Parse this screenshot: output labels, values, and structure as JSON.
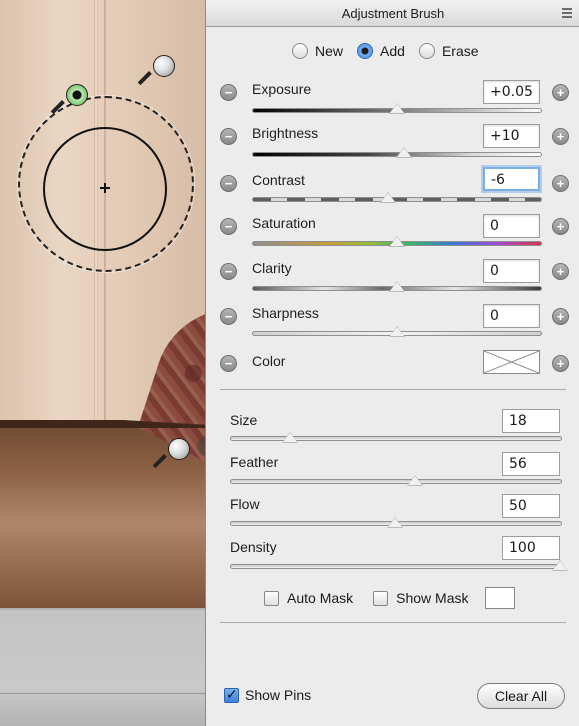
{
  "panel": {
    "title": "Adjustment Brush",
    "menu_icon": "panel-menu-icon"
  },
  "modes": [
    {
      "label": "New",
      "selected": false
    },
    {
      "label": "Add",
      "selected": true
    },
    {
      "label": "Erase",
      "selected": false
    }
  ],
  "adjustments": [
    {
      "label": "Exposure",
      "value": "+0.05",
      "slider_fraction": 0.5,
      "track": "exposure"
    },
    {
      "label": "Brightness",
      "value": "+10",
      "slider_fraction": 0.53,
      "track": "brightness"
    },
    {
      "label": "Contrast",
      "value": "-6",
      "slider_fraction": 0.47,
      "track": "contrast",
      "focused": true
    },
    {
      "label": "Saturation",
      "value": "0",
      "slider_fraction": 0.5,
      "track": "saturation"
    },
    {
      "label": "Clarity",
      "value": "0",
      "slider_fraction": 0.5,
      "track": "clarity"
    },
    {
      "label": "Sharpness",
      "value": "0",
      "slider_fraction": 0.5,
      "track": "sharpness"
    }
  ],
  "color": {
    "label": "Color"
  },
  "brush": [
    {
      "label": "Size",
      "value": "18",
      "slider_fraction": 0.18
    },
    {
      "label": "Feather",
      "value": "56",
      "slider_fraction": 0.56
    },
    {
      "label": "Flow",
      "value": "50",
      "slider_fraction": 0.5
    },
    {
      "label": "Density",
      "value": "100",
      "slider_fraction": 1.0
    }
  ],
  "options": {
    "auto_mask": {
      "label": "Auto Mask",
      "checked": false
    },
    "show_mask": {
      "label": "Show Mask",
      "checked": false
    }
  },
  "footer": {
    "show_pins": {
      "label": "Show Pins",
      "checked": true
    },
    "clear_all": "Clear All"
  }
}
